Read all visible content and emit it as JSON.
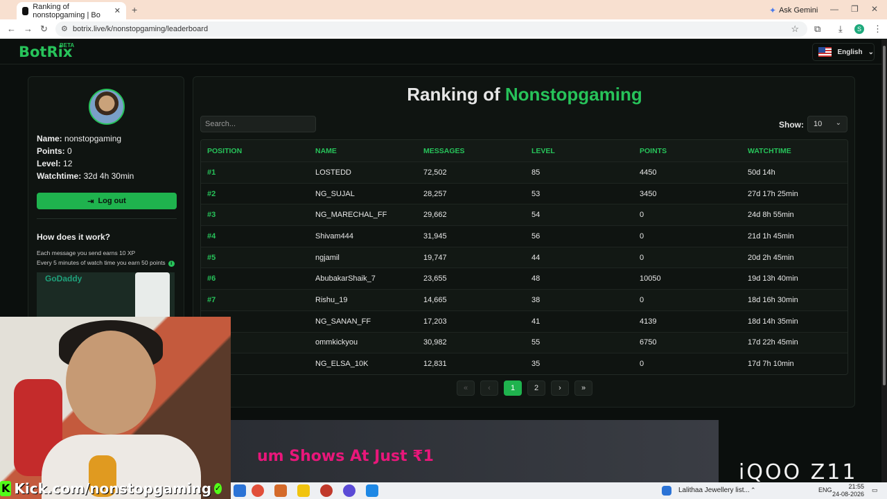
{
  "browser": {
    "tab_title": "Ranking of nonstopgaming | Bo",
    "tab_close": "✕",
    "new_tab": "+",
    "ask_gemini": "Ask Gemini",
    "url": "botrix.live/k/nonstopgaming/leaderboard",
    "profile_initial": "S"
  },
  "site": {
    "logo": "BotRix",
    "beta": "BETA",
    "language": "English"
  },
  "profile": {
    "name_label": "Name:",
    "name_value": "nonstopgaming",
    "points_label": "Points:",
    "points_value": "0",
    "level_label": "Level:",
    "level_value": "12",
    "watchtime_label": "Watchtime:",
    "watchtime_value": "32d 4h 30min",
    "logout_label": "Log out",
    "how_title": "How does it work?",
    "how_line1": "Each message you send earns 10 XP",
    "how_line2": "Every 5 minutes of watch time you earn 50 points",
    "ad_text": "GoDaddy"
  },
  "leaderboard": {
    "title_prefix": "Ranking of ",
    "title_name": "Nonstopgaming",
    "search_placeholder": "Search...",
    "show_label": "Show:",
    "show_value": "10",
    "columns": [
      "Position",
      "Name",
      "Messages",
      "Level",
      "Points",
      "Watchtime"
    ],
    "rows": [
      [
        "#1",
        "LOSTEDD",
        "72,502",
        "85",
        "4450",
        "50d 14h"
      ],
      [
        "#2",
        "NG_SUJAL",
        "28,257",
        "53",
        "3450",
        "27d 17h 25min"
      ],
      [
        "#3",
        "NG_MARECHAL_FF",
        "29,662",
        "54",
        "0",
        "24d 8h 55min"
      ],
      [
        "#4",
        "Shivam444",
        "31,945",
        "56",
        "0",
        "21d 1h 45min"
      ],
      [
        "#5",
        "ngjamil",
        "19,747",
        "44",
        "0",
        "20d 2h 45min"
      ],
      [
        "#6",
        "AbubakarShaik_7",
        "23,655",
        "48",
        "10050",
        "19d 13h 40min"
      ],
      [
        "#7",
        "Rishu_19",
        "14,665",
        "38",
        "0",
        "18d 16h 30min"
      ],
      [
        "",
        "NG_SANAN_FF",
        "17,203",
        "41",
        "4139",
        "18d 14h 35min"
      ],
      [
        "",
        "ommkickyou",
        "30,982",
        "55",
        "6750",
        "17d 22h 45min"
      ],
      [
        "",
        "NG_ELSA_10K",
        "12,831",
        "35",
        "0",
        "17d 7h 10min"
      ]
    ],
    "pager": {
      "first": "«",
      "prev": "‹",
      "page1": "1",
      "page2": "2",
      "next": "›",
      "last": "»"
    }
  },
  "overlay": {
    "banner_text": "um Shows At Just ₹1",
    "brand": "iQOO Z11",
    "kick_text": "Kick.com/nonstopgaming"
  },
  "taskbar": {
    "window_label": "Lalithaa Jewellery list...",
    "lang": "ENG",
    "time": "21:55",
    "date": "24-08-2026"
  },
  "colors": {
    "accent": "#27c35a",
    "background": "#0b0f0d"
  }
}
